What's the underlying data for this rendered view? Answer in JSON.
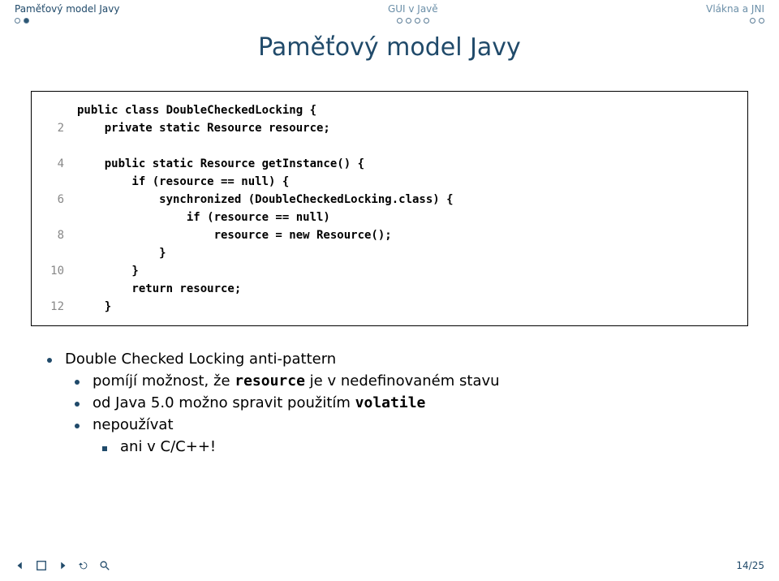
{
  "header": {
    "sections": {
      "left": {
        "label": "Paměťový model Javy",
        "dots": [
          false,
          true
        ]
      },
      "center": {
        "label": "GUI v Javě",
        "dots": [
          false,
          false,
          false,
          false
        ]
      },
      "right": {
        "label": "Vlákna a JNI",
        "dots": [
          false,
          false
        ]
      }
    }
  },
  "title": "Paměťový model Javy",
  "code": {
    "line_numbers": [
      "",
      "2",
      "",
      "4",
      "",
      "6",
      "",
      "8",
      "",
      "10",
      "",
      "12"
    ],
    "lines": [
      "public class DoubleCheckedLocking {",
      "    private static Resource resource;",
      "",
      "    public static Resource getInstance() {",
      "        if (resource == null) {",
      "            synchronized (DoubleCheckedLocking.class) {",
      "                if (resource == null)",
      "                    resource = new Resource();",
      "            }",
      "        }",
      "        return resource;",
      "    }"
    ]
  },
  "bullets": {
    "b1": "Double Checked Locking anti-pattern",
    "b2a_pre": "pomíjí možnost, že ",
    "b2a_code": "resource",
    "b2a_post": " je v nedefinovaném stavu",
    "b2b_pre": "od Java 5.0 možno spravit použitím ",
    "b2b_code": "volatile",
    "b2c": "nepoužívat",
    "b3": "ani v C/C++!"
  },
  "footer": {
    "page": "14/25"
  }
}
